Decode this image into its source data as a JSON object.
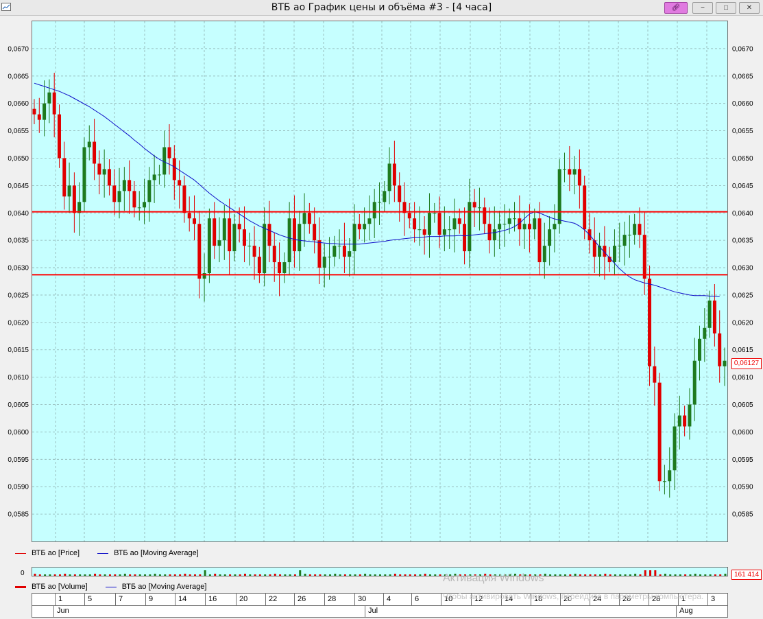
{
  "window": {
    "title": "ВТБ ао График цены и объёма #3 - [4 часа]"
  },
  "colors": {
    "background": "#c6ffff",
    "up_candle": "#1e7a1e",
    "down_candle": "#e00000",
    "moving_average": "#1010c8",
    "level_line": "#ff0000",
    "grid": "#8fb0b0"
  },
  "legend": {
    "price": "ВТБ ао [Price]",
    "price_ma": "ВТБ ао [Moving Average]",
    "volume": "ВТБ ао [Volume]",
    "volume_ma": "ВТБ ао [Moving Average]"
  },
  "last_price_label": "0,06127",
  "volume_zero_label": "0",
  "volume_last_label": "161 414",
  "date_axis": {
    "days": [
      "1",
      "5",
      "7",
      "9",
      "14",
      "16",
      "20",
      "22",
      "26",
      "28",
      "30",
      "4",
      "6",
      "10",
      "12",
      "14",
      "18",
      "20",
      "24",
      "26",
      "28",
      "1",
      "3"
    ],
    "months": [
      "Jun",
      "Jul",
      "Aug"
    ]
  },
  "watermark": {
    "title": "Активация Windows",
    "subtitle": "Чтобы активировать Windows, перейдите в параметры компьютера."
  },
  "chart_data": {
    "type": "candlestick",
    "title": "",
    "ylim": [
      0.058,
      0.0675
    ],
    "yticks": [
      "0,0585",
      "0,0590",
      "0,0595",
      "0,0600",
      "0,0605",
      "0,0610",
      "0,0615",
      "0,0620",
      "0,0625",
      "0,0630",
      "0,0635",
      "0,0640",
      "0,0645",
      "0,0650",
      "0,0655",
      "0,0660",
      "0,0665",
      "0,0670"
    ],
    "grid": true,
    "horizontal_levels": [
      0.06402,
      0.06287
    ],
    "close": [
      0.0658,
      0.0657,
      0.066,
      0.0662,
      0.0658,
      0.065,
      0.0643,
      0.0645,
      0.064,
      0.0642,
      0.0652,
      0.0653,
      0.0649,
      0.0647,
      0.0648,
      0.0645,
      0.0642,
      0.0644,
      0.0646,
      0.0644,
      0.0641,
      0.0641,
      0.0642,
      0.0646,
      0.0647,
      0.0647,
      0.0652,
      0.065,
      0.0646,
      0.0645,
      0.064,
      0.0639,
      0.0638,
      0.0628,
      0.0629,
      0.0639,
      0.0634,
      0.0635,
      0.0639,
      0.0633,
      0.0638,
      0.0637,
      0.0634,
      0.0634,
      0.0632,
      0.0629,
      0.0638,
      0.0634,
      0.0631,
      0.0629,
      0.0631,
      0.0639,
      0.0633,
      0.0638,
      0.064,
      0.0638,
      0.0635,
      0.063,
      0.0632,
      0.0632,
      0.0634,
      0.0634,
      0.0632,
      0.0633,
      0.0638,
      0.0637,
      0.0638,
      0.0639,
      0.0642,
      0.0642,
      0.0644,
      0.0649,
      0.0645,
      0.0642,
      0.064,
      0.0639,
      0.0637,
      0.0637,
      0.0636,
      0.064,
      0.064,
      0.0636,
      0.0637,
      0.0637,
      0.0639,
      0.0638,
      0.0633,
      0.0642,
      0.0641,
      0.0641,
      0.0638,
      0.0635,
      0.0637,
      0.0638,
      0.0638,
      0.0639,
      0.0639,
      0.0637,
      0.0638,
      0.0637,
      0.0639,
      0.0631,
      0.0634,
      0.0637,
      0.0638,
      0.0648,
      0.0648,
      0.0647,
      0.0648,
      0.0645,
      0.0637,
      0.0635,
      0.0632,
      0.0634,
      0.0632,
      0.0631,
      0.0634,
      0.0634,
      0.0636,
      0.0636,
      0.0638,
      0.0636,
      0.0628,
      0.0612,
      0.0609,
      0.0591,
      0.0591,
      0.0593,
      0.0601,
      0.0603,
      0.0601,
      0.0605,
      0.0613,
      0.0617,
      0.0619,
      0.0624,
      0.0618,
      0.0612,
      0.0613
    ],
    "ma": [
      0.06637,
      0.06634,
      0.06631,
      0.06628,
      0.06625,
      0.06622,
      0.06618,
      0.06614,
      0.06609,
      0.06604,
      0.06599,
      0.06594,
      0.06588,
      0.06582,
      0.06576,
      0.06569,
      0.06562,
      0.06555,
      0.06548,
      0.06541,
      0.06533,
      0.06526,
      0.06518,
      0.06511,
      0.06504,
      0.06498,
      0.06493,
      0.06489,
      0.06484,
      0.06478,
      0.06472,
      0.06466,
      0.0646,
      0.06452,
      0.06444,
      0.06436,
      0.06429,
      0.06422,
      0.06416,
      0.0641,
      0.06404,
      0.06398,
      0.06392,
      0.06386,
      0.06381,
      0.06376,
      0.06372,
      0.06368,
      0.06364,
      0.0636,
      0.06357,
      0.06354,
      0.06352,
      0.0635,
      0.06349,
      0.06348,
      0.06347,
      0.06346,
      0.06345,
      0.06344,
      0.06344,
      0.06343,
      0.06343,
      0.06343,
      0.06343,
      0.06343,
      0.06344,
      0.06345,
      0.06346,
      0.06347,
      0.06348,
      0.0635,
      0.06351,
      0.06352,
      0.06353,
      0.06354,
      0.06355,
      0.06355,
      0.06356,
      0.06357,
      0.06357,
      0.06357,
      0.06358,
      0.06358,
      0.06358,
      0.06359,
      0.06358,
      0.06359,
      0.0636,
      0.06361,
      0.06362,
      0.06363,
      0.06364,
      0.06366,
      0.06368,
      0.06371,
      0.06375,
      0.06381,
      0.0639,
      0.06398,
      0.06402,
      0.064,
      0.06396,
      0.06392,
      0.06389,
      0.06387,
      0.06385,
      0.06383,
      0.06381,
      0.06376,
      0.06369,
      0.0636,
      0.06349,
      0.06338,
      0.06328,
      0.06318,
      0.06308,
      0.06298,
      0.0629,
      0.06283,
      0.06278,
      0.06275,
      0.06272,
      0.0627,
      0.06268,
      0.06265,
      0.06262,
      0.06259,
      0.06256,
      0.06254,
      0.06252,
      0.0625,
      0.06249,
      0.06249,
      0.06249,
      0.06248,
      0.06248,
      0.06247
    ]
  }
}
